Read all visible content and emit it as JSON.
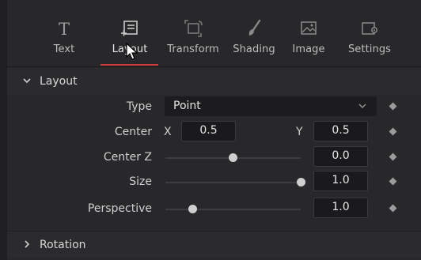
{
  "tabs": [
    {
      "label": "Text",
      "icon": "text-icon"
    },
    {
      "label": "Layout",
      "icon": "layout-icon",
      "active": true
    },
    {
      "label": "Transform",
      "icon": "transform-icon"
    },
    {
      "label": "Shading",
      "icon": "shading-brush-icon"
    },
    {
      "label": "Image",
      "icon": "image-icon"
    },
    {
      "label": "Settings",
      "icon": "settings-icon"
    }
  ],
  "layout_section": {
    "title": "Layout",
    "type_label": "Type",
    "type_value": "Point",
    "center_label": "Center",
    "center_x_label": "X",
    "center_x_value": "0.5",
    "center_y_label": "Y",
    "center_y_value": "0.5",
    "center_z_label": "Center Z",
    "center_z_value": "0.0",
    "center_z_slider": 0.5,
    "size_label": "Size",
    "size_value": "1.0",
    "size_slider": 1.0,
    "perspective_label": "Perspective",
    "perspective_value": "1.0",
    "perspective_slider": 0.2
  },
  "rotation_section": {
    "title": "Rotation"
  },
  "colors": {
    "active_tab_underline": "#d33a3a",
    "panel_bg": "#28282a"
  }
}
